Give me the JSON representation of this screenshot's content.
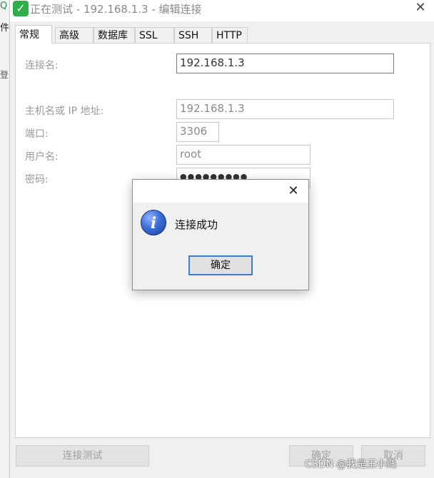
{
  "background_window": {
    "menu_text": "件",
    "side_text": "登录"
  },
  "dialog": {
    "title": "正在测试 - 192.168.1.3 - 编辑连接",
    "close_glyph": "✕",
    "tabs": [
      {
        "label": "常规",
        "active": true
      },
      {
        "label": "高级",
        "active": false
      },
      {
        "label": "数据库",
        "active": false
      },
      {
        "label": "SSL",
        "active": false
      },
      {
        "label": "SSH",
        "active": false
      },
      {
        "label": "HTTP",
        "active": false
      }
    ],
    "form": {
      "connection_name_label": "连接名:",
      "connection_name_value": "192.168.1.3",
      "host_label": "主机名或 IP 地址:",
      "host_value": "192.168.1.3",
      "port_label": "端口:",
      "port_value": "3306",
      "user_label": "用户名:",
      "user_value": "root",
      "password_label": "密码:",
      "password_value": "●●●●●●●●●"
    },
    "buttons": {
      "test_connection": "连接测试",
      "ok": "确定",
      "cancel": "取消"
    }
  },
  "message_box": {
    "close_glyph": "✕",
    "icon": "info-icon",
    "icon_glyph": "i",
    "message": "连接成功",
    "ok_label": "确定"
  },
  "watermark": "CSDN @我是王小贱",
  "colors": {
    "accent": "#3c7fd1",
    "logo": "#2fae4a"
  }
}
